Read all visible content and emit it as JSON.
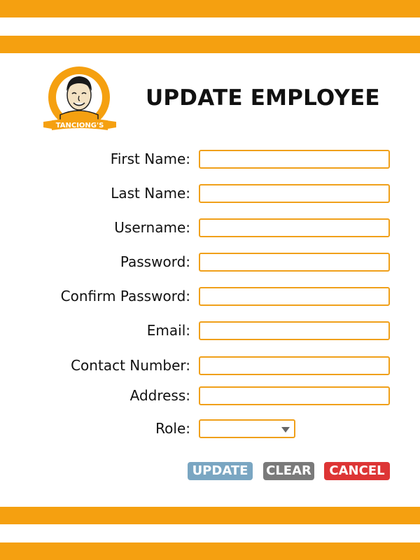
{
  "header": {
    "title": "UPDATE EMPLOYEE"
  },
  "logo": {
    "text": "TANCIONG'S",
    "icon": "cartoon-man-face-logo"
  },
  "form": {
    "fields": [
      {
        "label": "First Name:",
        "value": "",
        "type": "text"
      },
      {
        "label": "Last Name:",
        "value": "",
        "type": "text"
      },
      {
        "label": "Username:",
        "value": "",
        "type": "text"
      },
      {
        "label": "Password:",
        "value": "",
        "type": "password"
      },
      {
        "label": "Confirm Password:",
        "value": "",
        "type": "password"
      },
      {
        "label": "Email:",
        "value": "",
        "type": "text"
      },
      {
        "label": "Contact Number:",
        "value": "",
        "type": "text"
      },
      {
        "label": "Address:",
        "value": "",
        "type": "text"
      }
    ],
    "role": {
      "label": "Role:",
      "selected": ""
    }
  },
  "buttons": {
    "update": "UPDATE",
    "clear": "CLEAR",
    "cancel": "CANCEL"
  },
  "colors": {
    "accent_orange": "#f5a010",
    "update_button": "#7aa6c2",
    "clear_button": "#7a7a7a",
    "cancel_button": "#dd3535"
  }
}
